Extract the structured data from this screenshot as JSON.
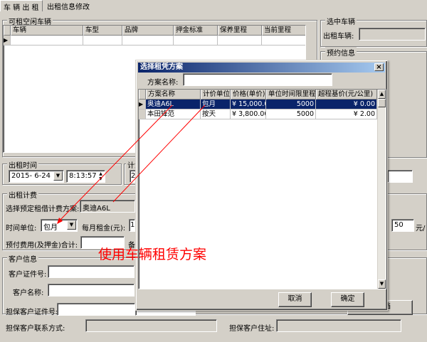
{
  "tabs": [
    "车 辆 出 租",
    "出租信息修改"
  ],
  "available_cars": {
    "title": "可租空闲车辆",
    "columns": [
      "车辆",
      "车型",
      "品牌",
      "押金标准",
      "保养里程",
      "当前里程"
    ]
  },
  "selected_car": {
    "title": "选中车辆",
    "label": "出租车辆:",
    "value": ""
  },
  "reserve": {
    "title": "预约信息"
  },
  "rent_time": {
    "title": "出租时间",
    "date": "2015- 6-24",
    "time": "8:13:57",
    "plan_title_fragment": "计划",
    "plan_value_fragment": "2"
  },
  "fee": {
    "title": "出租计费",
    "plan_label": "选择预定租借计费方案:",
    "plan_value": "奥迪A6L",
    "unit_label": "时间单位:",
    "unit_value": "包月",
    "monthly_label": "每月租金(元):",
    "monthly_value": "1",
    "prepay_label": "预付费用(及押金)合计:",
    "prepay_value": "",
    "note_fragment": "备",
    "right_value": "50",
    "right_unit": "元/"
  },
  "customer": {
    "title": "客户信息",
    "id_label": "客户证件号:",
    "name_label": "客户名称:",
    "guarantor_id_label": "担保客户证件号:",
    "guarantor_contact_label": "担保客户联系方式:",
    "guarantor_addr_label": "担保客户住址:",
    "archive_fragment": "户建档"
  },
  "dialog": {
    "title": "选择租凭方案",
    "search_label": "方案名称:",
    "search_value": "",
    "columns": [
      "方案名称",
      "计价单位",
      "价格(单价)",
      "单位时间限里程",
      "超程基价(元/公里)"
    ],
    "rows": [
      [
        "奥迪A6L",
        "包月",
        "¥ 15,000.00",
        "5000",
        "¥ 0.00"
      ],
      [
        "本田锋范",
        "按天",
        "¥ 3,800.00",
        "5000",
        "¥ 2.00"
      ]
    ],
    "cancel_label": "取消",
    "ok_label": "确定"
  },
  "annotation": "使用车辆租赁方案",
  "colors": {
    "accent": "#0a246a",
    "annotation": "#ff0000",
    "selected_row": "#0a246a"
  }
}
